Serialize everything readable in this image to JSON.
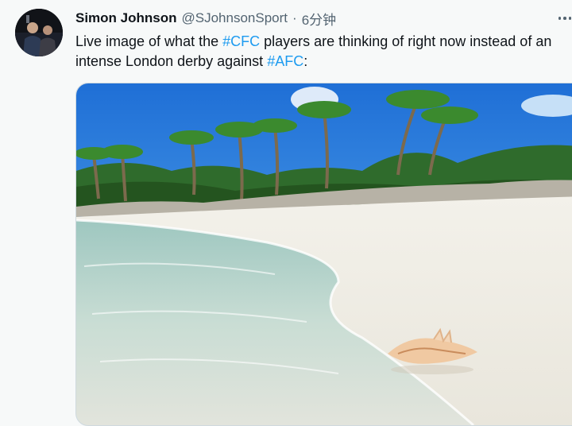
{
  "tweet": {
    "author_name": "Simon Johnson",
    "handle": "@SJohnsonSport",
    "separator": "·",
    "time": "6分钟",
    "text_parts": {
      "p1": "Live image of what the ",
      "tag1": "#CFC",
      "p2": " players are thinking of right now instead of an intense London derby against ",
      "tag2": "#AFC",
      "p3": ":"
    }
  },
  "icons": {
    "more": "more-horizontal-icon"
  },
  "colors": {
    "hashtag": "#1d9bf0",
    "secondary_text": "#536471",
    "primary_text": "#0f1419",
    "background": "#f7f9f9"
  }
}
